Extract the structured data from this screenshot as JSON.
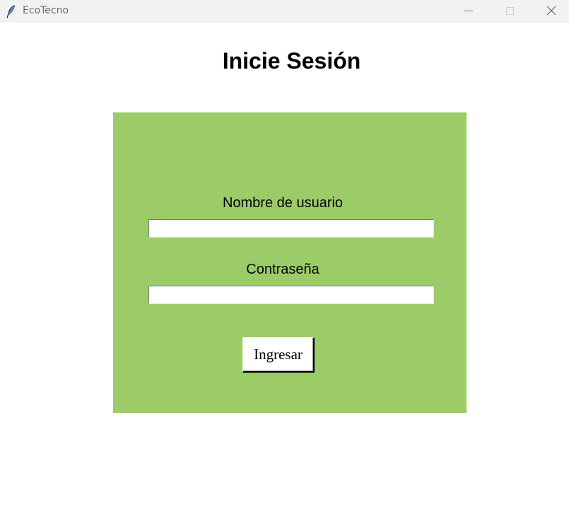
{
  "window": {
    "title": "EcoTecno",
    "icon": "feather-icon",
    "controls": [
      "minimize-icon",
      "maximize-icon",
      "close-icon"
    ]
  },
  "login": {
    "heading": "Inicie Sesión",
    "username_label": "Nombre de usuario",
    "username_value": "",
    "password_label": "Contraseña",
    "password_value": "",
    "submit_label": "Ingresar"
  },
  "colors": {
    "panel_background": "#9ccc68",
    "window_background": "#ffffff",
    "titlebar_background": "#f2f2f2"
  }
}
